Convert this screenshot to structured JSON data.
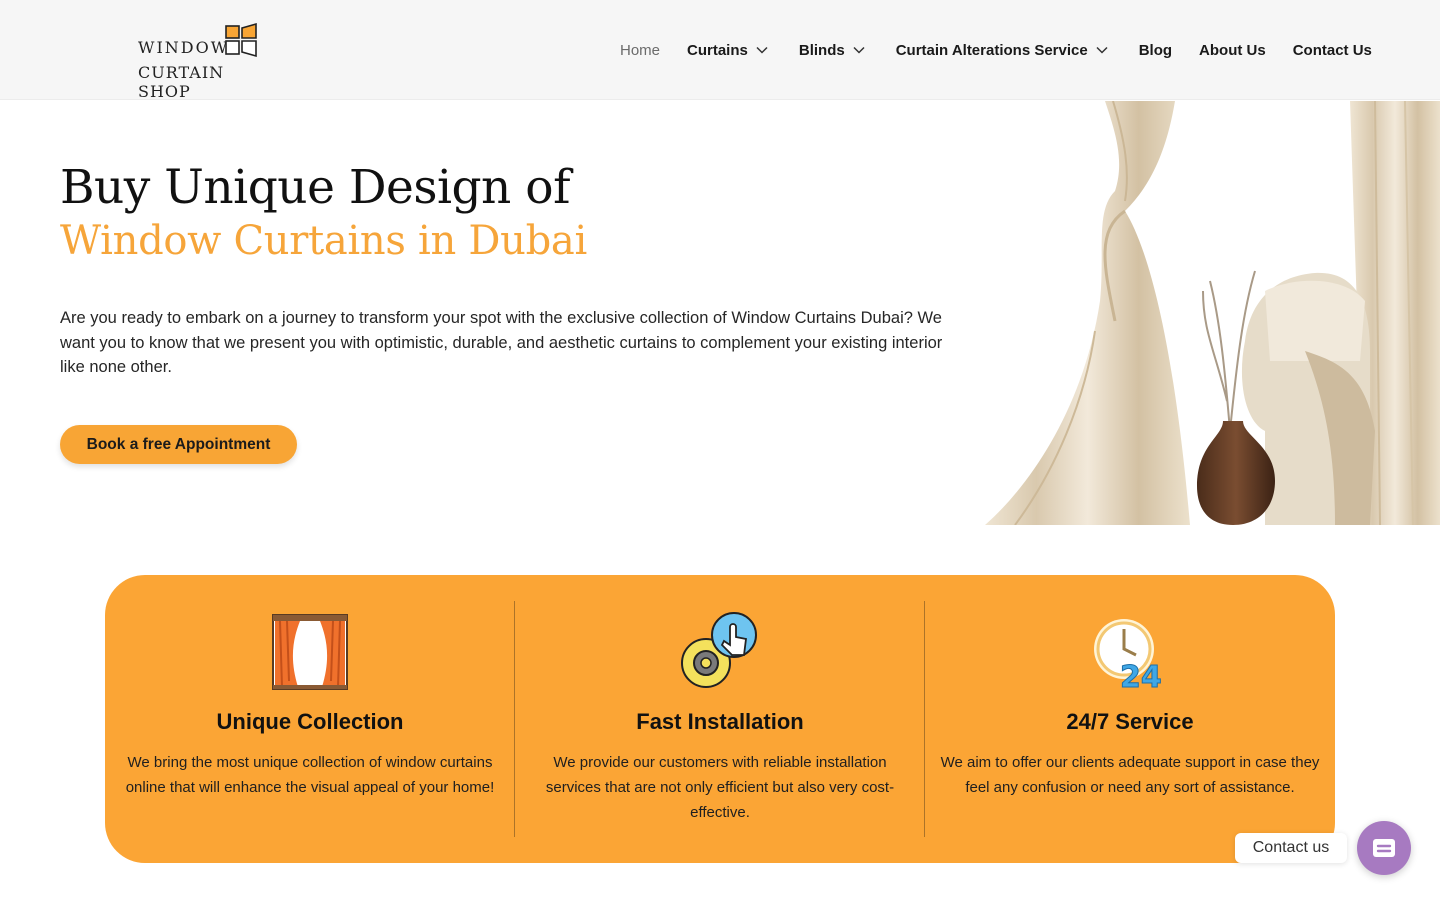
{
  "brand": {
    "line1": "WINDOW",
    "line2": "CURTAIN SHOP"
  },
  "nav": {
    "items": [
      {
        "label": "Home",
        "dropdown": false,
        "active": true
      },
      {
        "label": "Curtains",
        "dropdown": true
      },
      {
        "label": "Blinds",
        "dropdown": true
      },
      {
        "label": "Curtain Alterations Service",
        "dropdown": true
      },
      {
        "label": "Blog",
        "dropdown": false
      },
      {
        "label": "About Us",
        "dropdown": false
      },
      {
        "label": "Contact Us",
        "dropdown": false
      }
    ]
  },
  "hero": {
    "title": "Buy Unique Design of",
    "subtitle": "Window Curtains in Dubai",
    "body": "Are you ready to embark on a journey to transform your spot with the exclusive collection of Window Curtains Dubai? We want you to know that we present you with optimistic, durable, and aesthetic curtains to complement your existing interior like none other.",
    "cta_label": "Book a free Appointment"
  },
  "features": [
    {
      "icon": "curtain-window-icon",
      "title": "Unique Collection",
      "text": "We bring the most unique collection of window curtains online that will enhance the visual appeal of your home!"
    },
    {
      "icon": "gear-touch-icon",
      "title": "Fast Installation",
      "text": "We provide our customers with reliable installation services that are not only efficient but also very cost-effective."
    },
    {
      "icon": "clock-24-icon",
      "title": "24/7 Service",
      "text": "We aim to offer our clients adequate support in case they feel any confusion or need any sort of assistance."
    }
  ],
  "contact_widget": {
    "label": "Contact us"
  },
  "colors": {
    "accent": "#f8a535",
    "band": "#fba535",
    "header_bg": "#f6f6f6",
    "contact_button": "#a77ac1"
  }
}
